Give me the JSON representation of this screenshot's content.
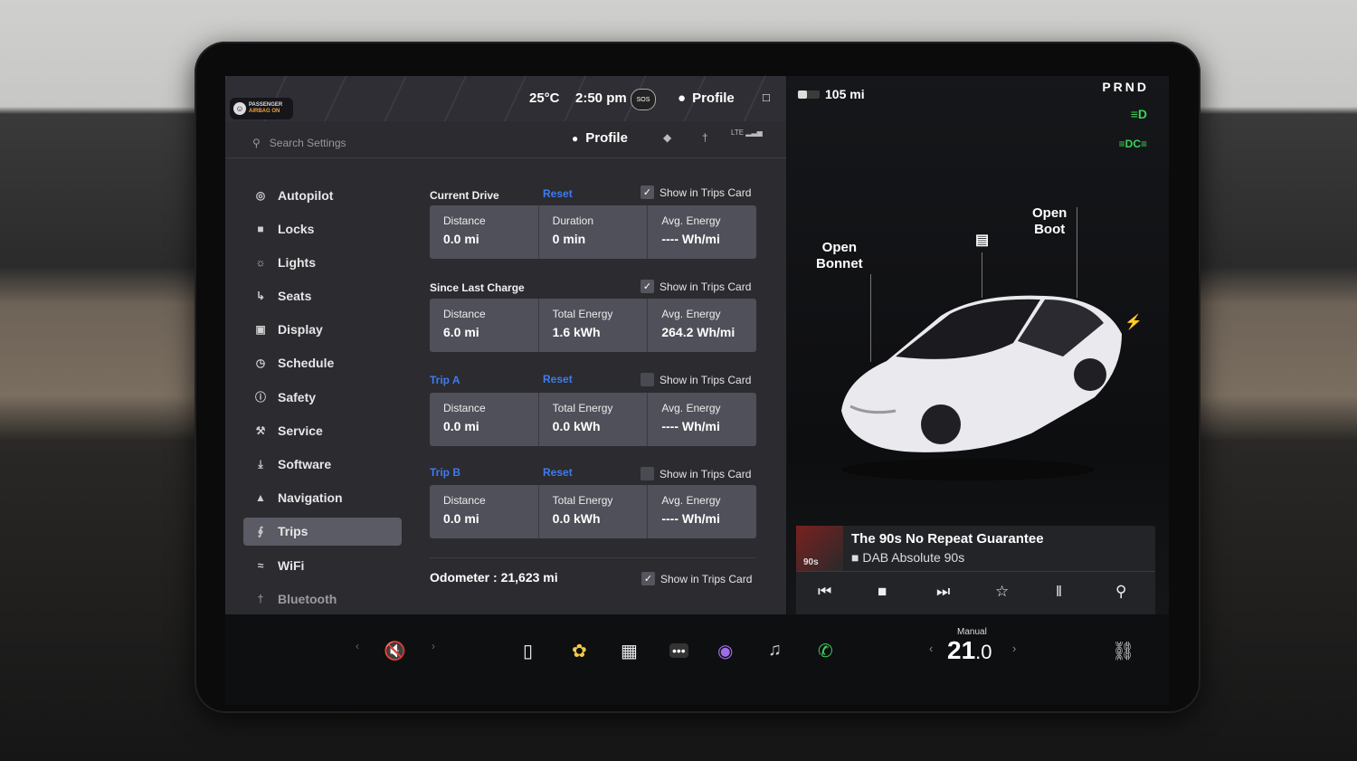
{
  "status": {
    "airbag": [
      "PASSENGER",
      "AIRBAG ON"
    ],
    "temperature": "25°C",
    "time": "2:50 pm",
    "sos": "SOS",
    "profile": "Profile"
  },
  "header": {
    "search_placeholder": "Search Settings",
    "profile": "Profile",
    "network": "LTE"
  },
  "nav": [
    {
      "label": "Autopilot",
      "icon": "steering-wheel-icon"
    },
    {
      "label": "Locks",
      "icon": "lock-icon"
    },
    {
      "label": "Lights",
      "icon": "light-icon"
    },
    {
      "label": "Seats",
      "icon": "seat-icon"
    },
    {
      "label": "Display",
      "icon": "display-icon"
    },
    {
      "label": "Schedule",
      "icon": "clock-icon"
    },
    {
      "label": "Safety",
      "icon": "safety-icon"
    },
    {
      "label": "Service",
      "icon": "wrench-icon"
    },
    {
      "label": "Software",
      "icon": "download-icon"
    },
    {
      "label": "Navigation",
      "icon": "navigation-icon"
    },
    {
      "label": "Trips",
      "icon": "trips-icon"
    },
    {
      "label": "WiFi",
      "icon": "wifi-icon"
    },
    {
      "label": "Bluetooth",
      "icon": "bluetooth-icon"
    }
  ],
  "trips": {
    "show_label": "Show in Trips Card",
    "reset_label": "Reset",
    "current": {
      "title": "Current Drive",
      "c1l": "Distance",
      "c1v": "0.0 mi",
      "c2l": "Duration",
      "c2v": "0 min",
      "c3l": "Avg. Energy",
      "c3v": "---- Wh/mi"
    },
    "since": {
      "title": "Since Last Charge",
      "c1l": "Distance",
      "c1v": "6.0 mi",
      "c2l": "Total Energy",
      "c2v": "1.6 kWh",
      "c3l": "Avg. Energy",
      "c3v": "264.2 Wh/mi"
    },
    "tripa": {
      "title": "Trip A",
      "c1l": "Distance",
      "c1v": "0.0 mi",
      "c2l": "Total Energy",
      "c2v": "0.0 kWh",
      "c3l": "Avg. Energy",
      "c3v": "---- Wh/mi"
    },
    "tripb": {
      "title": "Trip B",
      "c1l": "Distance",
      "c1v": "0.0 mi",
      "c2l": "Total Energy",
      "c2v": "0.0 kWh",
      "c3l": "Avg. Energy",
      "c3v": "---- Wh/mi"
    },
    "odometer": "Odometer : 21,623 mi"
  },
  "vehicle": {
    "range": "105 mi",
    "gear": "PRND",
    "open_bonnet": [
      "Open",
      "Bonnet"
    ],
    "open_boot": [
      "Open",
      "Boot"
    ]
  },
  "media": {
    "song": "The 90s No Repeat Guarantee",
    "station": "DAB Absolute 90s",
    "album_text": "90s"
  },
  "climate": {
    "mode": "Manual",
    "temp_whole": "21",
    "temp_dec": ".0"
  },
  "colors": {
    "accent": "#3d7cf0",
    "lights": "#3fd15a",
    "phone": "#3fd15a"
  }
}
